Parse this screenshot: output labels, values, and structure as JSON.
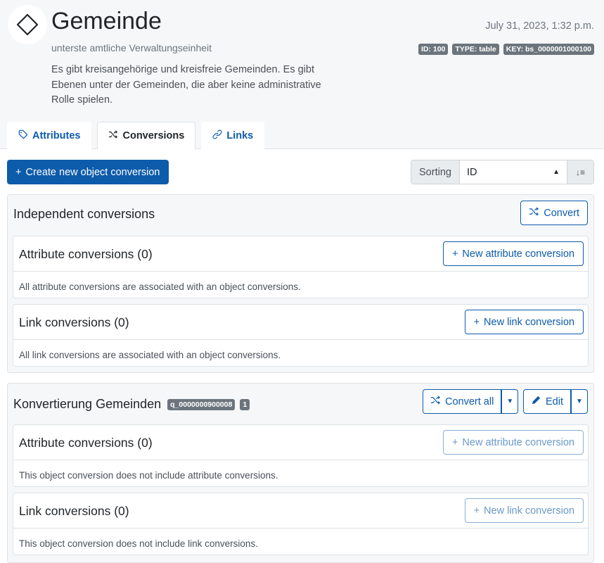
{
  "header": {
    "title": "Gemeinde",
    "subtitle": "unterste amtliche Verwaltungseinheit",
    "description": "Es gibt kreisangehörige und kreisfreie Gemeinden. Es gibt Ebenen unter der Gemeinden, die aber keine administrative Rolle spielen.",
    "timestamp": "July 31, 2023, 1:32 p.m.",
    "badges": {
      "id": "ID: 100",
      "type": "TYPE: table",
      "key": "KEY: bs_0000001000100"
    }
  },
  "tabs": [
    {
      "label": "Attributes",
      "icon": "tag-icon"
    },
    {
      "label": "Conversions",
      "icon": "shuffle-icon",
      "active": true
    },
    {
      "label": "Links",
      "icon": "link-icon"
    }
  ],
  "toolbar": {
    "create_label": "Create new object conversion",
    "sorting_label": "Sorting",
    "sorting_value": "ID"
  },
  "independent": {
    "title": "Independent conversions",
    "convert_label": "Convert",
    "attr": {
      "title": "Attribute conversions (0)",
      "button": "New attribute conversion",
      "message": "All attribute conversions are associated with an object conversions."
    },
    "link": {
      "title": "Link conversions (0)",
      "button": "New link conversion",
      "message": "All link conversions are associated with an object conversions."
    }
  },
  "konv": {
    "title": "Konvertierung Gemeinden",
    "key_badge": "q_0000000900008",
    "count_badge": "1",
    "convert_all_label": "Convert all",
    "edit_label": "Edit",
    "attr": {
      "title": "Attribute conversions (0)",
      "button": "New attribute conversion",
      "message": "This object conversion does not include attribute conversions."
    },
    "link": {
      "title": "Link conversions (0)",
      "button": "New link conversion",
      "message": "This object conversion does not include link conversions."
    }
  }
}
